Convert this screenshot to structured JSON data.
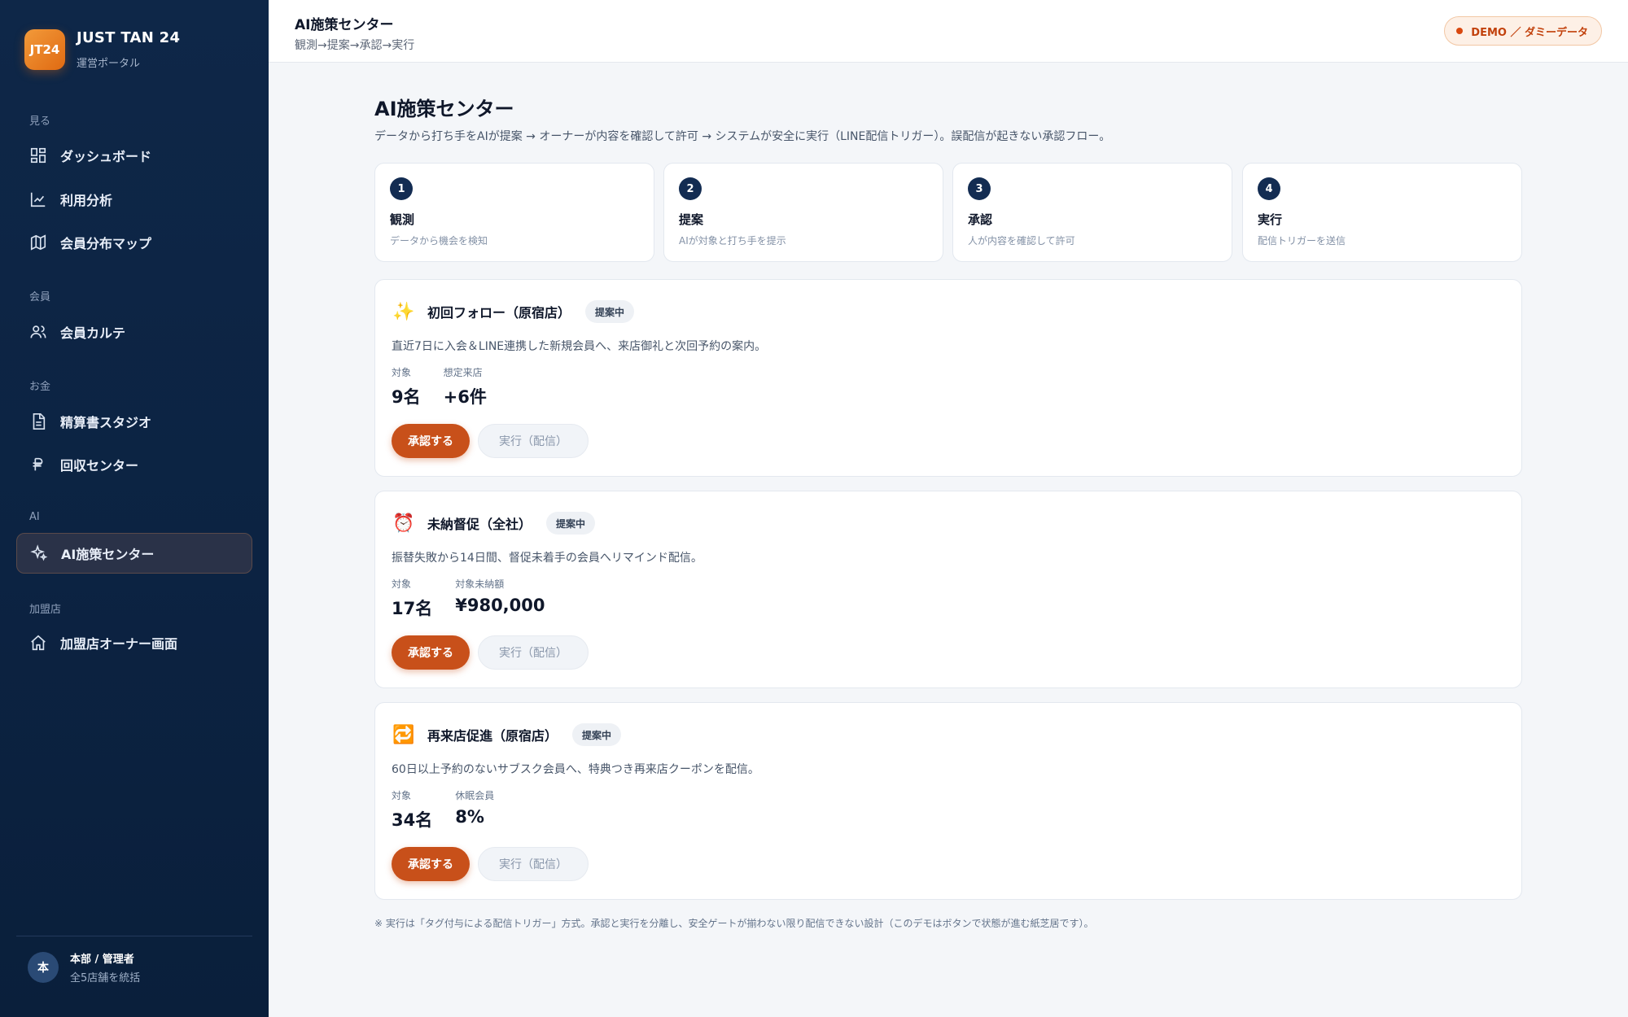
{
  "brand": {
    "logo": "JT24",
    "name": "JUST TAN 24",
    "sub": "運営ポータル"
  },
  "sidebar": {
    "sections": [
      {
        "label": "見る"
      },
      {
        "label": "会員"
      },
      {
        "label": "お金"
      },
      {
        "label": "AI"
      },
      {
        "label": "加盟店"
      }
    ],
    "items": [
      {
        "label": "ダッシュボード",
        "icon": "grid-icon"
      },
      {
        "label": "利用分析",
        "icon": "chart-line-icon"
      },
      {
        "label": "会員分布マップ",
        "icon": "map-icon"
      },
      {
        "label": "会員カルテ",
        "icon": "users-icon"
      },
      {
        "label": "精算書スタジオ",
        "icon": "document-icon"
      },
      {
        "label": "回収センター",
        "icon": "currency-icon"
      },
      {
        "label": "AI施策センター",
        "icon": "sparkle-icon",
        "active": true
      },
      {
        "label": "加盟店オーナー画面",
        "icon": "home-icon"
      }
    ],
    "user": {
      "avatar": "本",
      "name": "本部 / 管理者",
      "sub": "全5店舗を統括"
    }
  },
  "topbar": {
    "title": "AI施策センター",
    "sub": "観測→提案→承認→実行",
    "badge": "DEMO ／ ダミーデータ"
  },
  "main": {
    "title": "AI施策センター",
    "desc": "データから打ち手をAIが提案 → オーナーが内容を確認して許可 → システムが安全に実行（LINE配信トリガー）。誤配信が起きない承認フロー。",
    "steps": [
      {
        "num": "1",
        "title": "観測",
        "desc": "データから機会を検知"
      },
      {
        "num": "2",
        "title": "提案",
        "desc": "AIが対象と打ち手を提示"
      },
      {
        "num": "3",
        "title": "承認",
        "desc": "人が内容を確認して許可"
      },
      {
        "num": "4",
        "title": "実行",
        "desc": "配信トリガーを送信"
      }
    ],
    "cards": [
      {
        "icon": "✨",
        "title": "初回フォロー（原宿店）",
        "badge": "提案中",
        "desc": "直近7日に入会＆LINE連携した新規会員へ、来店御礼と次回予約の案内。",
        "metrics": [
          {
            "label": "対象",
            "value": "9名"
          },
          {
            "label": "想定来店",
            "value": "+6件"
          }
        ],
        "approve": "承認する",
        "exec": "実行（配信）"
      },
      {
        "icon": "⏰",
        "title": "未納督促（全社）",
        "badge": "提案中",
        "desc": "振替失敗から14日間、督促未着手の会員へリマインド配信。",
        "metrics": [
          {
            "label": "対象",
            "value": "17名"
          },
          {
            "label": "対象未納額",
            "value": "¥980,000"
          }
        ],
        "approve": "承認する",
        "exec": "実行（配信）"
      },
      {
        "icon": "🔁",
        "title": "再来店促進（原宿店）",
        "badge": "提案中",
        "desc": "60日以上予約のないサブスク会員へ、特典つき再来店クーポンを配信。",
        "metrics": [
          {
            "label": "対象",
            "value": "34名"
          },
          {
            "label": "休眠会員",
            "value": "8%"
          }
        ],
        "approve": "承認する",
        "exec": "実行（配信）"
      }
    ],
    "footnote": "※ 実行は「タグ付与による配信トリガー」方式。承認と実行を分離し、安全ゲートが揃わない限り配信できない設計（このデモはボタンで状態が進む紙芝居です）。"
  },
  "colors": {
    "accent": "#c8501a",
    "sidebar": "#0c2342",
    "step_num": "#132c52"
  }
}
